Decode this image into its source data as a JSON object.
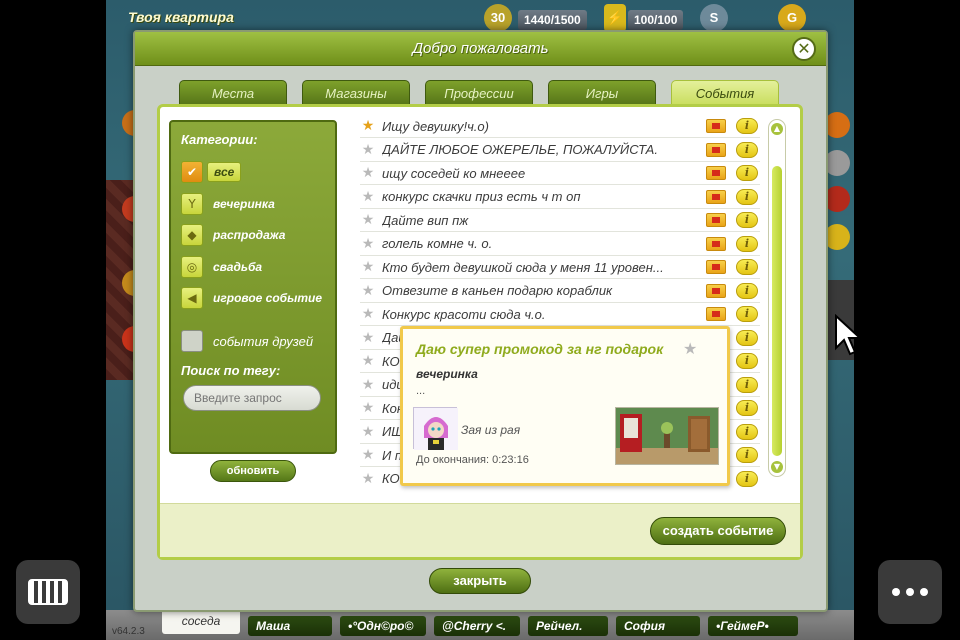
{
  "hud": {
    "location_title": "Твоя квартира",
    "level": "30",
    "energy": "1440/1500",
    "mood": "100/100",
    "silver_icon": "S",
    "gold_icon": "G"
  },
  "dialog": {
    "title": "Добро пожаловать",
    "close_icon": "✕",
    "tabs": [
      {
        "label": "Места",
        "active": false
      },
      {
        "label": "Магазины",
        "active": false
      },
      {
        "label": "Профессии",
        "active": false
      },
      {
        "label": "Игры",
        "active": false
      },
      {
        "label": "События",
        "active": true
      }
    ],
    "categories": {
      "heading": "Категории:",
      "items": [
        {
          "label": "все",
          "icon": "check-icon",
          "selected": true
        },
        {
          "label": "вечеринка",
          "icon": "cocktail-icon",
          "selected": false
        },
        {
          "label": "распродажа",
          "icon": "price-tag-icon",
          "selected": false
        },
        {
          "label": "свадьба",
          "icon": "rings-icon",
          "selected": false
        },
        {
          "label": "игровое событие",
          "icon": "megaphone-icon",
          "selected": false
        }
      ],
      "friends_events_label": "события друзей",
      "tag_search_heading": "Поиск по тегу:",
      "tag_search_placeholder": "Введите запрос",
      "refresh_label": "обновить"
    },
    "events": [
      {
        "title": "Ищу девушку!ч.о)",
        "starred": true
      },
      {
        "title": "ДАЙТЕ ЛЮБОЕ ОЖЕРЕЛЬЕ, ПОЖАЛУЙСТА.",
        "starred": false
      },
      {
        "title": "ищу соседей ко мнееее",
        "starred": false
      },
      {
        "title": "конкурс скачки приз есть ч т оп",
        "starred": false
      },
      {
        "title": "Дайте вип пж",
        "starred": false
      },
      {
        "title": "голель комне ч. о.",
        "starred": false
      },
      {
        "title": "Кто будет девушкой сюда у меня 11 уровен...",
        "starred": false
      },
      {
        "title": "Отвезите в каньен подарю кораблик",
        "starred": false
      },
      {
        "title": "Конкурс красоти сюда ч.о.",
        "starred": false
      },
      {
        "title": "Дай",
        "starred": false
      },
      {
        "title": "КОН",
        "starred": false
      },
      {
        "title": "иди",
        "starred": false
      },
      {
        "title": "Кон",
        "starred": false
      },
      {
        "title": "ИЩ",
        "starred": false
      },
      {
        "title": "И п",
        "starred": false
      },
      {
        "title": "КОН",
        "starred": false
      }
    ],
    "create_event_label": "создать событие",
    "close_label": "закрыть",
    "popup": {
      "title": "Даю супер промокод за нг подарок",
      "tag": "вечеринка",
      "description": "...",
      "author": "Зая из рая",
      "timer": "До окончания: 0:23:16"
    }
  },
  "bottom": {
    "version": "v64.2.3",
    "neighbors_label": "соседа",
    "friends": [
      "Маша",
      "•°Одн©ро©",
      "@Cherry <.",
      "Рейчел.",
      "София",
      "•ГеймеР•"
    ]
  },
  "colors": {
    "accent_green": "#7ea12b",
    "active_tab": "#dbea86",
    "popup_border": "#f1c94a"
  }
}
